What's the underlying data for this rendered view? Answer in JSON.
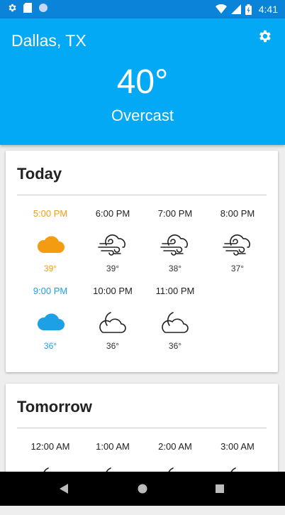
{
  "status_bar": {
    "time": "4:41"
  },
  "header": {
    "city": "Dallas, TX",
    "temperature": "40°",
    "condition": "Overcast"
  },
  "today": {
    "title": "Today",
    "hours": [
      {
        "time": "5:00 PM",
        "temp": "39°",
        "icon": "cloud-icon",
        "highlight": "orange"
      },
      {
        "time": "6:00 PM",
        "temp": "39°",
        "icon": "wind-cloud-icon"
      },
      {
        "time": "7:00 PM",
        "temp": "38°",
        "icon": "wind-cloud-icon"
      },
      {
        "time": "8:00 PM",
        "temp": "37°",
        "icon": "wind-cloud-icon"
      },
      {
        "time": "9:00 PM",
        "temp": "36°",
        "icon": "cloud-icon",
        "highlight": "blue"
      },
      {
        "time": "10:00 PM",
        "temp": "36°",
        "icon": "moon-cloud-icon"
      },
      {
        "time": "11:00 PM",
        "temp": "36°",
        "icon": "moon-cloud-icon"
      }
    ]
  },
  "tomorrow": {
    "title": "Tomorrow",
    "hours": [
      {
        "time": "12:00 AM",
        "icon": "moon-cloud-icon"
      },
      {
        "time": "1:00 AM",
        "icon": "moon-cloud-icon"
      },
      {
        "time": "2:00 AM",
        "icon": "moon-cloud-icon"
      },
      {
        "time": "3:00 AM",
        "icon": "moon-cloud-icon"
      }
    ]
  },
  "colors": {
    "header": "#03a9f4",
    "status_bar": "#0a84d8",
    "orange": "#f39c12",
    "blue": "#1ea0e6"
  }
}
